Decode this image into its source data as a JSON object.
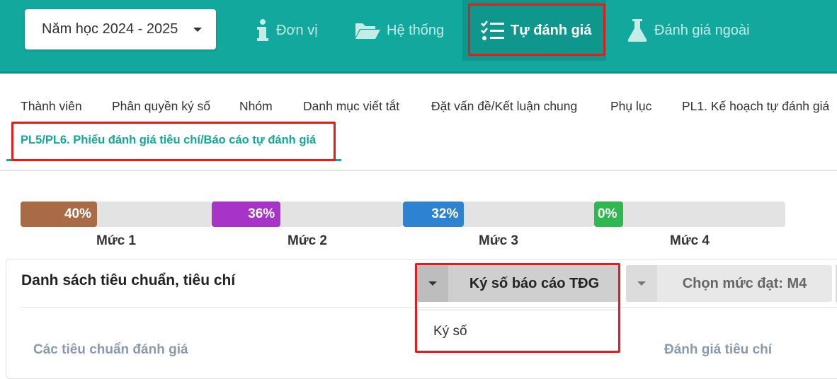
{
  "header": {
    "year_select": "Năm học 2024 - 2025",
    "nav": [
      {
        "label": "Đơn vị",
        "icon": "info-icon"
      },
      {
        "label": "Hệ thống",
        "icon": "folder-open-icon"
      },
      {
        "label": "Tự đánh giá",
        "icon": "task-list-icon",
        "active": true
      },
      {
        "label": "Đánh giá ngoài",
        "icon": "flask-icon"
      }
    ]
  },
  "tabs": [
    "Thành viên",
    "Phân quyền ký số",
    "Nhóm",
    "Danh mục viết tắt",
    "Đặt vấn đề/Kết luận chung",
    "Phụ lục",
    "PL1. Kế hoạch tự đánh giá",
    "PL5/PL6. Phiếu đánh giá tiêu chí/Báo cáo tự đánh giá"
  ],
  "active_tab": "PL5/PL6. Phiếu đánh giá tiêu chí/Báo cáo tự đánh giá",
  "levels": [
    {
      "label": "Mức 1",
      "percent_text": "40%",
      "percent": 40,
      "color": "#a86b45"
    },
    {
      "label": "Mức 2",
      "percent_text": "36%",
      "percent": 36,
      "color": "#a733c9"
    },
    {
      "label": "Mức 3",
      "percent_text": "32%",
      "percent": 32,
      "color": "#2d83d2"
    },
    {
      "label": "Mức 4",
      "percent_text": "0%",
      "percent": 0,
      "color": "#2eb84f"
    }
  ],
  "card": {
    "title": "Danh sách tiêu chuẩn, tiêu chí",
    "kyso_button": "Ký số báo cáo TĐG",
    "muc_button": "Chọn mức đạt: M4",
    "dropdown_items": [
      "Ký số"
    ],
    "columns": [
      "Các tiêu chuẩn đánh giá",
      "Đánh giá tiêu chí"
    ]
  },
  "colors": {
    "primary": "#12a89d",
    "highlight": "#e31d1d"
  }
}
